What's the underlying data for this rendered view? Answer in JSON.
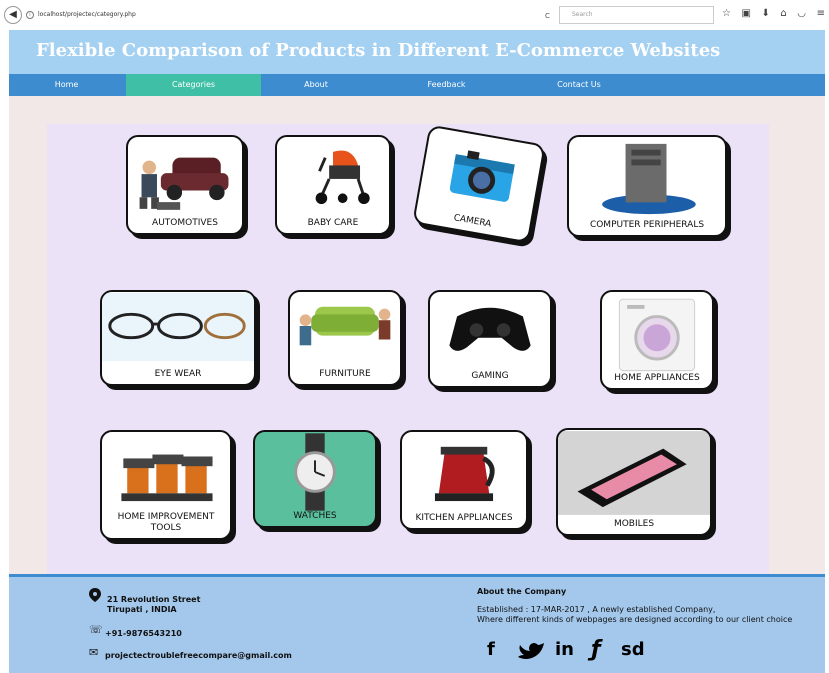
{
  "browser": {
    "url": "localhost/projectec/category.php",
    "search_placeholder": "Search",
    "back_glyph": "◀",
    "reload_glyph": "C"
  },
  "header": {
    "title": "Flexible Comparison of Products in Different E-Commerce Websites"
  },
  "nav": {
    "items": [
      "Home",
      "Categories",
      "About",
      "Feedback",
      "Contact Us"
    ],
    "active": "Categories"
  },
  "categories": [
    "AUTOMOTIVES",
    "BABY CARE",
    "CAMERA",
    "COMPUTER PERIPHERALS",
    "EYE WEAR",
    "FURNITURE",
    "GAMING",
    "HOME APPLIANCES",
    "HOME IMPROVEMENT TOOLS",
    "WATCHES",
    "KITCHEN APPLIANCES",
    "MOBILES"
  ],
  "footer": {
    "address_line1": "21 Revolution Street",
    "address_line2": "Tirupati , INDIA",
    "phone": "+91-9876543210",
    "email": "projectectroublefreecompare@gmail.com",
    "about_title": "About the Company",
    "about_line1": "Established : 17-MAR-2017 , A newly established Company,",
    "about_line2": "Where different kinds of webpages are designed according to our client choice",
    "social": [
      "f",
      "in",
      "ƒ",
      "sd"
    ]
  },
  "colors": {
    "header": "#a4d0f2",
    "nav": "#3d8ccf",
    "nav_active": "#3fbfa6",
    "content": "#ece2f7",
    "footer": "#a4c8ec"
  }
}
